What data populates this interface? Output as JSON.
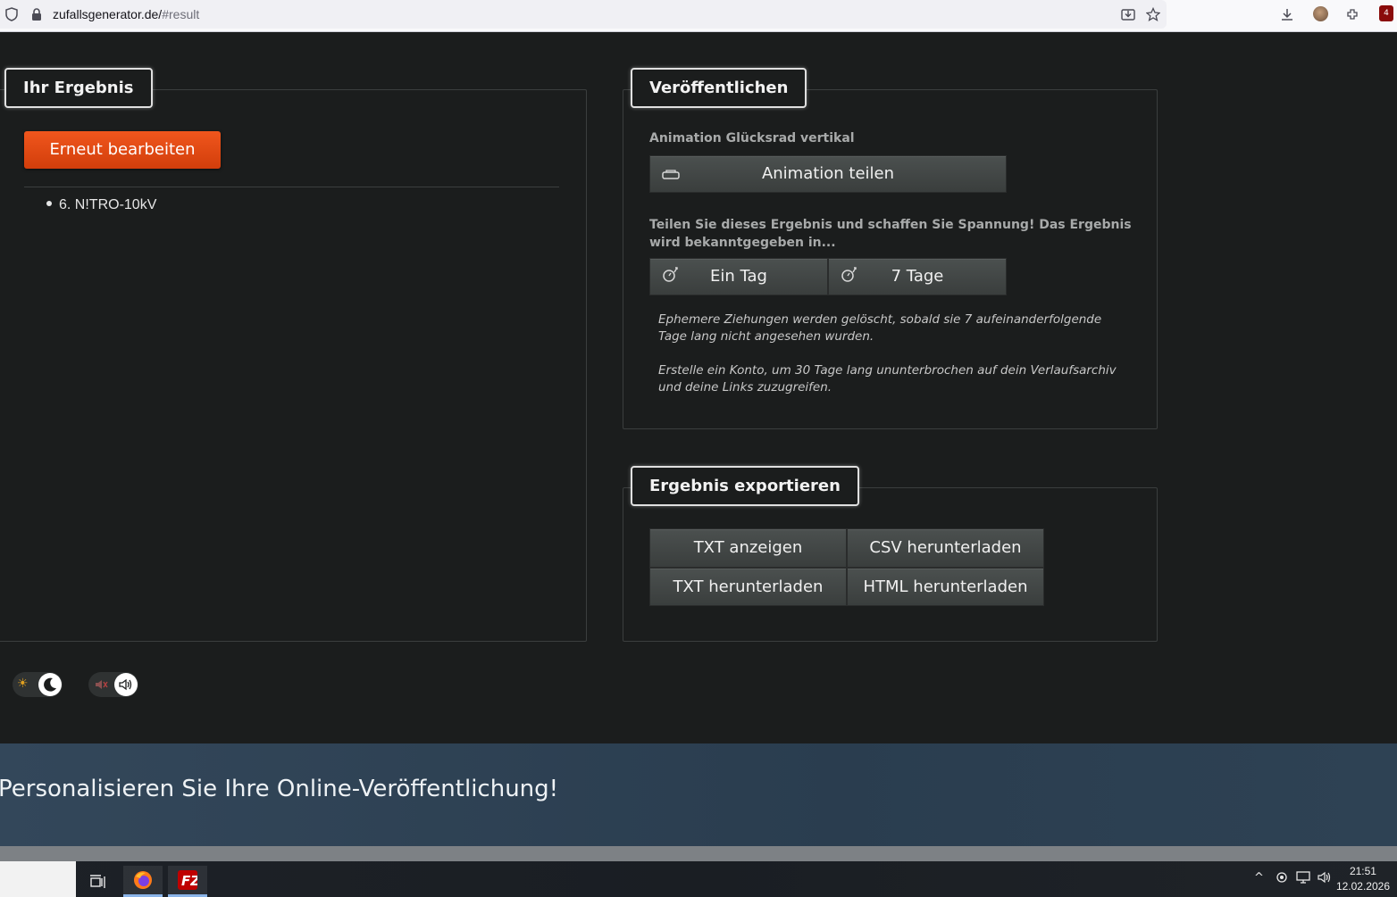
{
  "browser": {
    "url_domain": "zufallsgenerator.de/",
    "url_path": "#result",
    "extension_badge": "4"
  },
  "result_panel": {
    "legend": "Ihr Ergebnis",
    "edit_button": "Erneut bearbeiten",
    "items": [
      "6. N!TRO-10kV"
    ]
  },
  "publish_panel": {
    "legend": "Veröffentlichen",
    "animation_label": "Animation Glücksrad vertikal",
    "share_animation_button": "Animation teilen",
    "share_prompt": "Teilen Sie dieses Ergebnis und schaffen Sie Spannung! Das Ergebnis wird bekanntgegeben in...",
    "delay_options": [
      "Ein Tag",
      "7 Tage"
    ],
    "note_ephemeral": "Ephemere Ziehungen werden gelöscht, sobald sie 7 aufeinanderfolgende Tage lang nicht angesehen wurden.",
    "note_account": "Erstelle ein Konto, um 30 Tage lang ununterbrochen auf dein Verlaufsarchiv und deine Links zuzugreifen."
  },
  "export_panel": {
    "legend": "Ergebnis exportieren",
    "buttons": [
      "TXT anzeigen",
      "CSV herunterladen",
      "TXT herunterladen",
      "HTML herunterladen"
    ]
  },
  "toggles": {
    "theme": "dark",
    "sound": "on"
  },
  "banner": {
    "text": "Personalisieren Sie Ihre Online-Veröffentlichung!"
  },
  "taskbar": {
    "time": "21:51",
    "date": "12.02.2026"
  },
  "colors": {
    "accent_orange": "#e84a12",
    "background": "#1b1d1d",
    "button_gray": "#434847",
    "banner": "#2f4355"
  }
}
